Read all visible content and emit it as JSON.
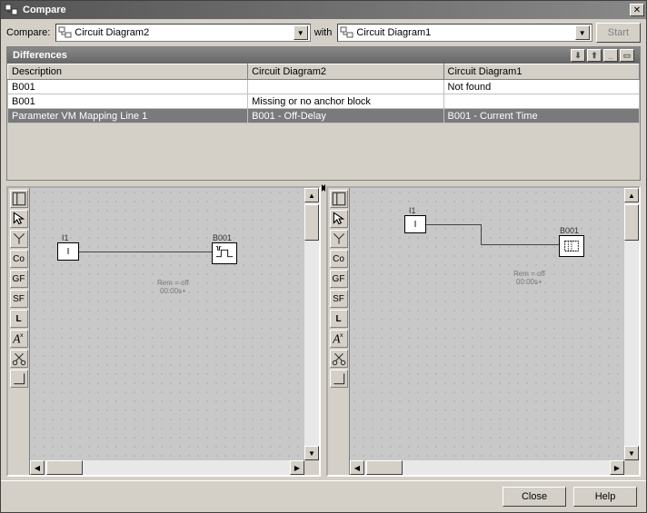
{
  "window": {
    "title": "Compare"
  },
  "toolbar": {
    "compare_label": "Compare:",
    "with_label": "with",
    "start_label": "Start",
    "left_value": "Circuit Diagram2",
    "right_value": "Circuit Diagram1"
  },
  "differences": {
    "title": "Differences",
    "columns": [
      "Description",
      "Circuit Diagram2",
      "Circuit Diagram1"
    ],
    "rows": [
      {
        "desc": "B001",
        "c2": "",
        "c1": "Not found",
        "selected": false
      },
      {
        "desc": "B001",
        "c2": "Missing or no anchor block",
        "c1": "",
        "selected": false
      },
      {
        "desc": "Parameter VM Mapping Line 1",
        "c2": "B001 - Off-Delay",
        "c1": "B001 - Current Time",
        "selected": true
      }
    ]
  },
  "diagram_left": {
    "input_label": "I1",
    "input_content": "I",
    "block_label": "B001",
    "note_line1": "Rem = off",
    "note_line2": "00:00s+"
  },
  "diagram_right": {
    "input_label": "I1",
    "input_content": "I",
    "block_label": "B001",
    "note_line1": "Rem = off",
    "note_line2": "00:00s+"
  },
  "toolbox_labels": {
    "popout": "popout-icon",
    "pointer": "pointer-icon",
    "connect": "connect-icon",
    "co": "Co",
    "gf": "GF",
    "sf": "SF",
    "l": "L",
    "text": "text-tool-icon",
    "cut": "cut-icon",
    "corner": "corner-icon"
  },
  "footer": {
    "close_label": "Close",
    "help_label": "Help"
  }
}
